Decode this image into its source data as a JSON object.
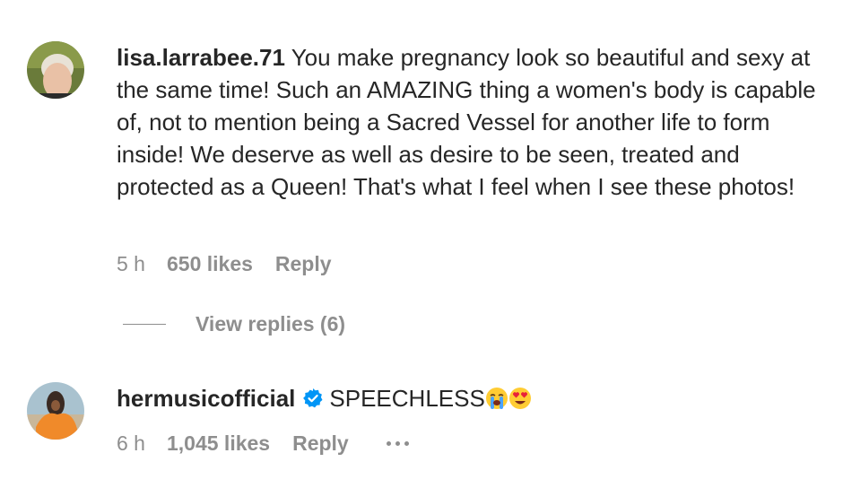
{
  "comments": [
    {
      "username": "lisa.larrabee.71",
      "text": "You make pregnancy look so beautiful and sexy at the same time! Such an AMAZING thing a women's body is capable of, not to mention being a Sacred Vessel for another life to form inside! We deserve as well as desire to be seen, treated and protected as a Queen! That's what I feel when I see these photos!",
      "time": "5 h",
      "likes": "650 likes",
      "reply": "Reply",
      "view_replies": "View replies (6)"
    },
    {
      "username": "hermusicofficial",
      "verified": true,
      "text": "SPEECHLESS",
      "emojis": [
        "loudly-crying-face",
        "heart-eyes-face"
      ],
      "time": "6 h",
      "likes": "1,045 likes",
      "reply": "Reply"
    }
  ],
  "colors": {
    "text": "#262626",
    "secondary": "#8e8e8e",
    "verified": "#0095f6"
  }
}
